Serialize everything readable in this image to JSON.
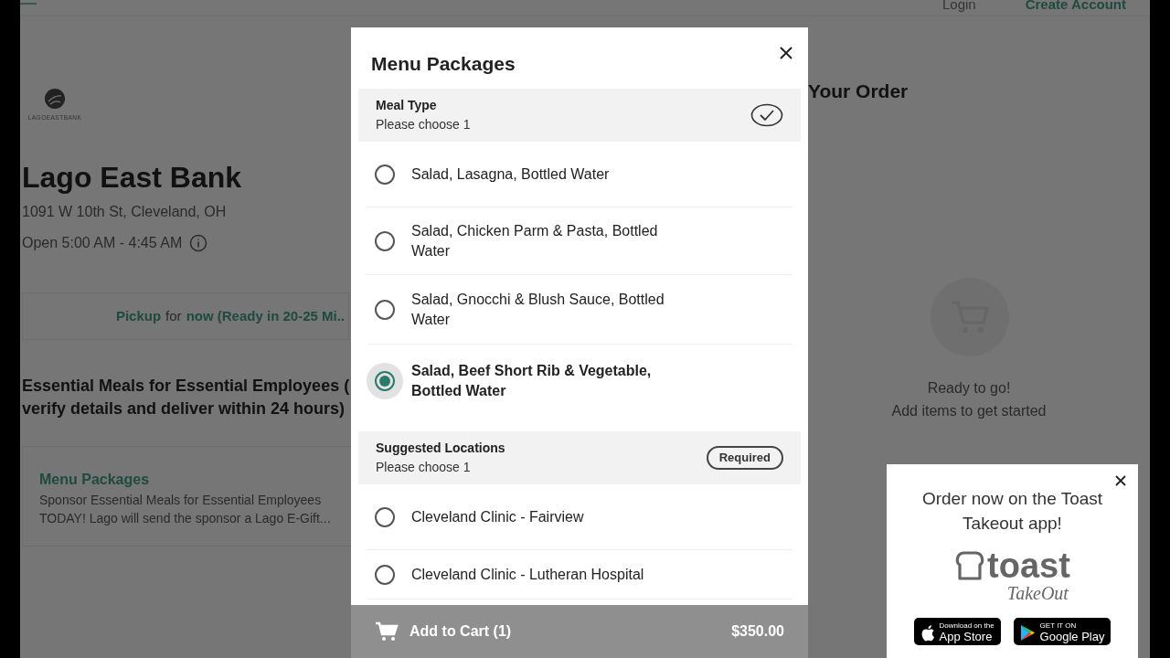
{
  "header": {
    "login": "Login",
    "create_account": "Create Account"
  },
  "restaurant": {
    "logo_text": "LAGOEASTBANK",
    "name": "Lago East Bank",
    "address": "1091 W 10th St, Cleveland, OH",
    "hours": "Open 5:00 AM - 4:45 AM"
  },
  "fulfillment": [
    {
      "text": "Pickup",
      "emphasis": true
    },
    {
      "text": "for",
      "emphasis": false
    },
    {
      "text": "now (Ready in 20-25 Mi..",
      "emphasis": true
    }
  ],
  "menu_heading_lines": [
    "Essential Meals for Essential Employees (",
    "verify details and deliver within 24 hours)"
  ],
  "menu_card": {
    "title": "Menu Packages",
    "description_lines": [
      "Sponsor Essential Meals for Essential Employees",
      "TODAY! Lago will send the sponsor a Lago E-Gift..."
    ]
  },
  "order": {
    "title": "Your Order",
    "empty_title": "Ready to go!",
    "empty_subtitle": "Add items to get started"
  },
  "modal": {
    "title": "Menu Packages",
    "groups": [
      {
        "name": "Meal Type",
        "hint": "Please choose 1",
        "kind": "done",
        "options": [
          {
            "label": "Salad, Lasagna, Bottled Water",
            "selected": false
          },
          {
            "label": "Salad, Chicken Parm & Pasta, Bottled Water",
            "selected": false
          },
          {
            "label": "Salad, Gnocchi & Blush Sauce, Bottled Water",
            "selected": false
          },
          {
            "label": "Salad, Beef Short Rib & Vegetable, Bottled Water",
            "selected": true
          }
        ]
      },
      {
        "name": "Suggested Locations",
        "hint": "Please choose 1",
        "kind": "required",
        "badge": "Required",
        "options": [
          {
            "label": "Cleveland Clinic - Fairview",
            "selected": false
          },
          {
            "label": "Cleveland Clinic - Lutheran Hospital",
            "selected": false
          }
        ]
      }
    ],
    "footer": {
      "label": "Add to Cart (1)",
      "price": "$350.00",
      "disabled": true
    }
  },
  "app_promo": {
    "title": "Order now on the Toast Takeout app!",
    "logo_word": "toast",
    "logo_sub": "TakeOut",
    "badges": [
      {
        "kind": "apple",
        "small": "Download on the",
        "big": "App Store"
      },
      {
        "kind": "google",
        "small": "GET IT ON",
        "big": "Google Play"
      }
    ]
  }
}
